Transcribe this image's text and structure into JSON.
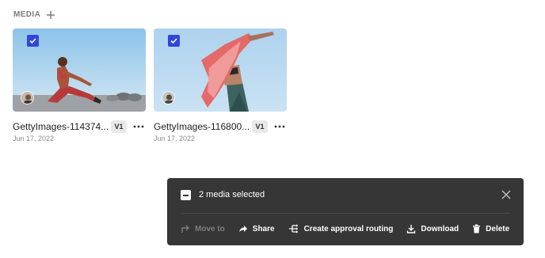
{
  "section": {
    "title": "MEDIA"
  },
  "media": [
    {
      "name": "GettyImages-114374...",
      "date": "Jun 17, 2022",
      "version": "V1",
      "selected": true
    },
    {
      "name": "GettyImages-116800...",
      "date": "Jun 17, 2022",
      "version": "V1",
      "selected": true
    }
  ],
  "selection_bar": {
    "count_label": "2 media selected",
    "actions": {
      "move_to": "Move to",
      "share": "Share",
      "approval": "Create approval routing",
      "download": "Download",
      "delete": "Delete"
    }
  },
  "colors": {
    "accent": "#3046d9",
    "toolbar_bg": "#363636",
    "muted_text": "#7b7b7b"
  },
  "icons": {
    "add": "plus-icon",
    "more": "ellipsis-icon",
    "close": "close-icon",
    "move_to": "move-arrow-icon",
    "share": "share-icon",
    "approval": "routing-icon",
    "download": "download-icon",
    "delete": "trash-icon"
  }
}
